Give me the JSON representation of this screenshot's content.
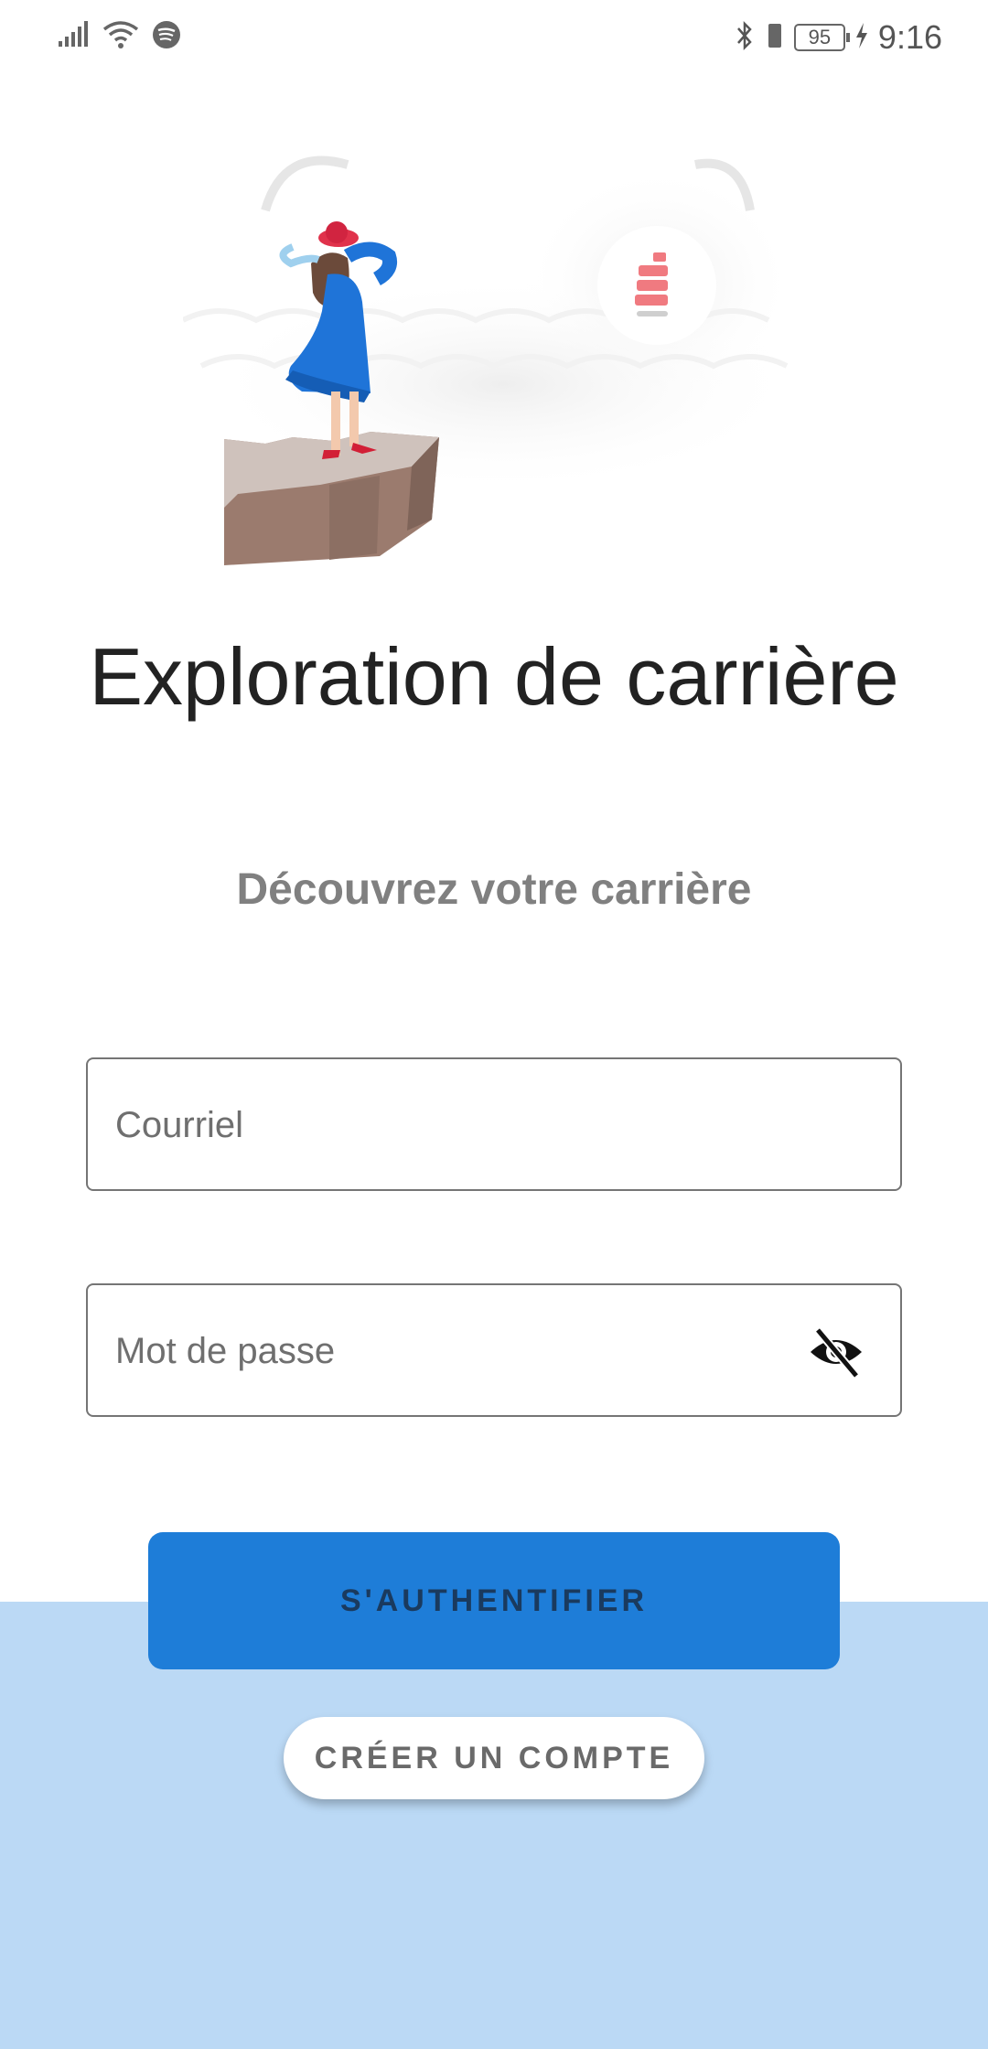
{
  "status_bar": {
    "time": "9:16",
    "battery_percent": "95",
    "icons": [
      "signal-icon",
      "wifi-icon",
      "spotify-icon",
      "bluetooth-icon",
      "vibrate-icon",
      "battery-icon",
      "charging-icon"
    ]
  },
  "illustration": {
    "name": "woman-on-cliff-illustration"
  },
  "header": {
    "title": "Exploration de carrière",
    "subtitle": "Découvrez votre carrière"
  },
  "form": {
    "email_placeholder": "Courriel",
    "email_value": "",
    "password_placeholder": "Mot de passe",
    "password_value": "",
    "password_toggle_icon": "eye-off-icon"
  },
  "actions": {
    "login_label": "S'AUTHENTIFIER",
    "create_account_label": "CRÉER UN COMPTE"
  },
  "colors": {
    "primary": "#1e7dd8",
    "bottom_band": "#bbd9f5",
    "title": "#222222",
    "subtitle": "#808080"
  }
}
